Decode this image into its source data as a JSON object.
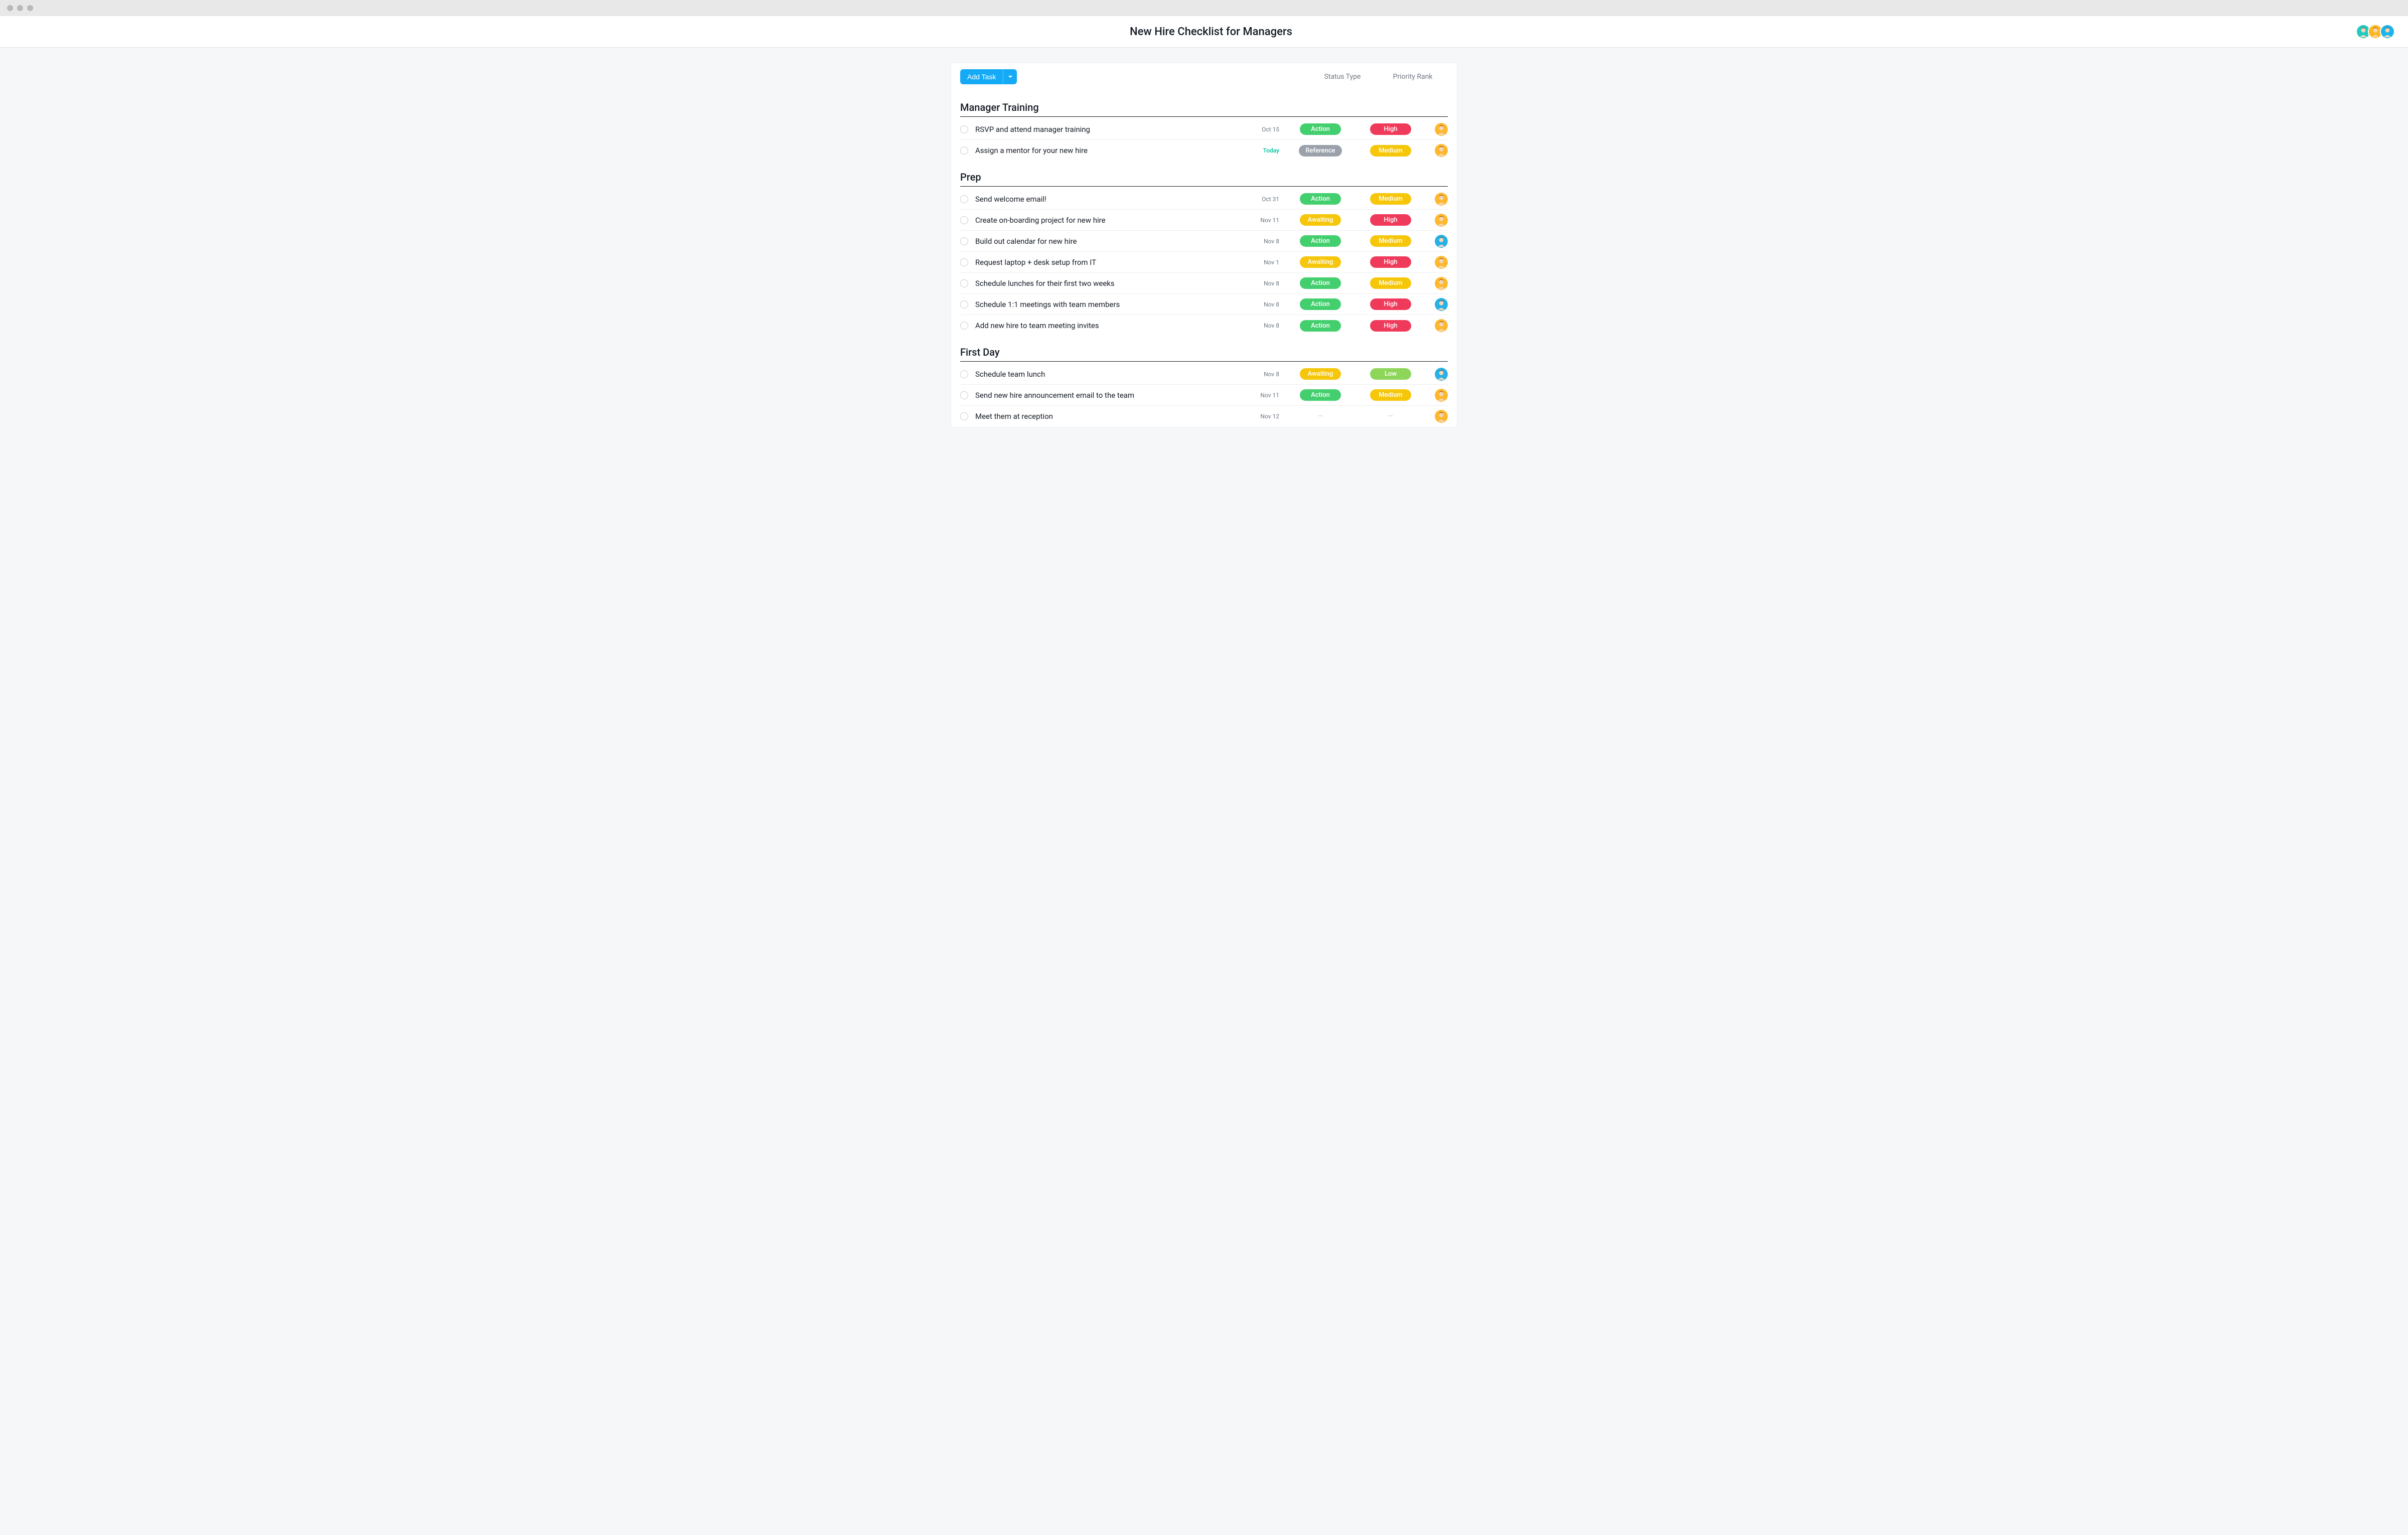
{
  "header": {
    "title": "New Hire Checklist for Managers",
    "collaborators": [
      {
        "color": "#2ec7bf"
      },
      {
        "color": "#ffb82e"
      },
      {
        "color": "#27b1e6"
      }
    ]
  },
  "toolbar": {
    "add_task_label": "Add Task",
    "columns": {
      "status": "Status Type",
      "priority": "Priority Rank"
    }
  },
  "status_styles": {
    "Action": "pill-action",
    "Reference": "pill-reference",
    "Awaiting": "pill-awaiting"
  },
  "priority_styles": {
    "High": "pill-high",
    "Medium": "pill-medium",
    "Low": "pill-low"
  },
  "assignee_colors": {
    "a": "#ffb82e",
    "b": "#27b1e6"
  },
  "sections": [
    {
      "title": "Manager Training",
      "tasks": [
        {
          "name": "RSVP and attend manager training",
          "date": "Oct 15",
          "date_today": false,
          "status": "Action",
          "priority": "High",
          "assignee": "a"
        },
        {
          "name": "Assign a mentor for your new hire",
          "date": "Today",
          "date_today": true,
          "status": "Reference",
          "priority": "Medium",
          "assignee": "a"
        }
      ]
    },
    {
      "title": "Prep",
      "tasks": [
        {
          "name": "Send welcome email!",
          "date": "Oct 31",
          "date_today": false,
          "status": "Action",
          "priority": "Medium",
          "assignee": "a"
        },
        {
          "name": "Create on-boarding project for new hire",
          "date": "Nov 11",
          "date_today": false,
          "status": "Awaiting",
          "priority": "High",
          "assignee": "a"
        },
        {
          "name": "Build out calendar for new hire",
          "date": "Nov 8",
          "date_today": false,
          "status": "Action",
          "priority": "Medium",
          "assignee": "b"
        },
        {
          "name": "Request laptop + desk setup from IT",
          "date": "Nov 1",
          "date_today": false,
          "status": "Awaiting",
          "priority": "High",
          "assignee": "a"
        },
        {
          "name": "Schedule lunches for their first two weeks",
          "date": "Nov 8",
          "date_today": false,
          "status": "Action",
          "priority": "Medium",
          "assignee": "a"
        },
        {
          "name": "Schedule 1:1 meetings with team members",
          "date": "Nov 8",
          "date_today": false,
          "status": "Action",
          "priority": "High",
          "assignee": "b"
        },
        {
          "name": "Add new hire to team meeting invites",
          "date": "Nov 8",
          "date_today": false,
          "status": "Action",
          "priority": "High",
          "assignee": "a"
        }
      ]
    },
    {
      "title": "First Day",
      "tasks": [
        {
          "name": "Schedule team lunch",
          "date": "Nov 8",
          "date_today": false,
          "status": "Awaiting",
          "priority": "Low",
          "assignee": "b"
        },
        {
          "name": "Send new hire announcement email to the team",
          "date": "Nov 11",
          "date_today": false,
          "status": "Action",
          "priority": "Medium",
          "assignee": "a"
        },
        {
          "name": "Meet them at reception",
          "date": "Nov 12",
          "date_today": false,
          "status": null,
          "priority": null,
          "assignee": "a"
        }
      ]
    }
  ]
}
